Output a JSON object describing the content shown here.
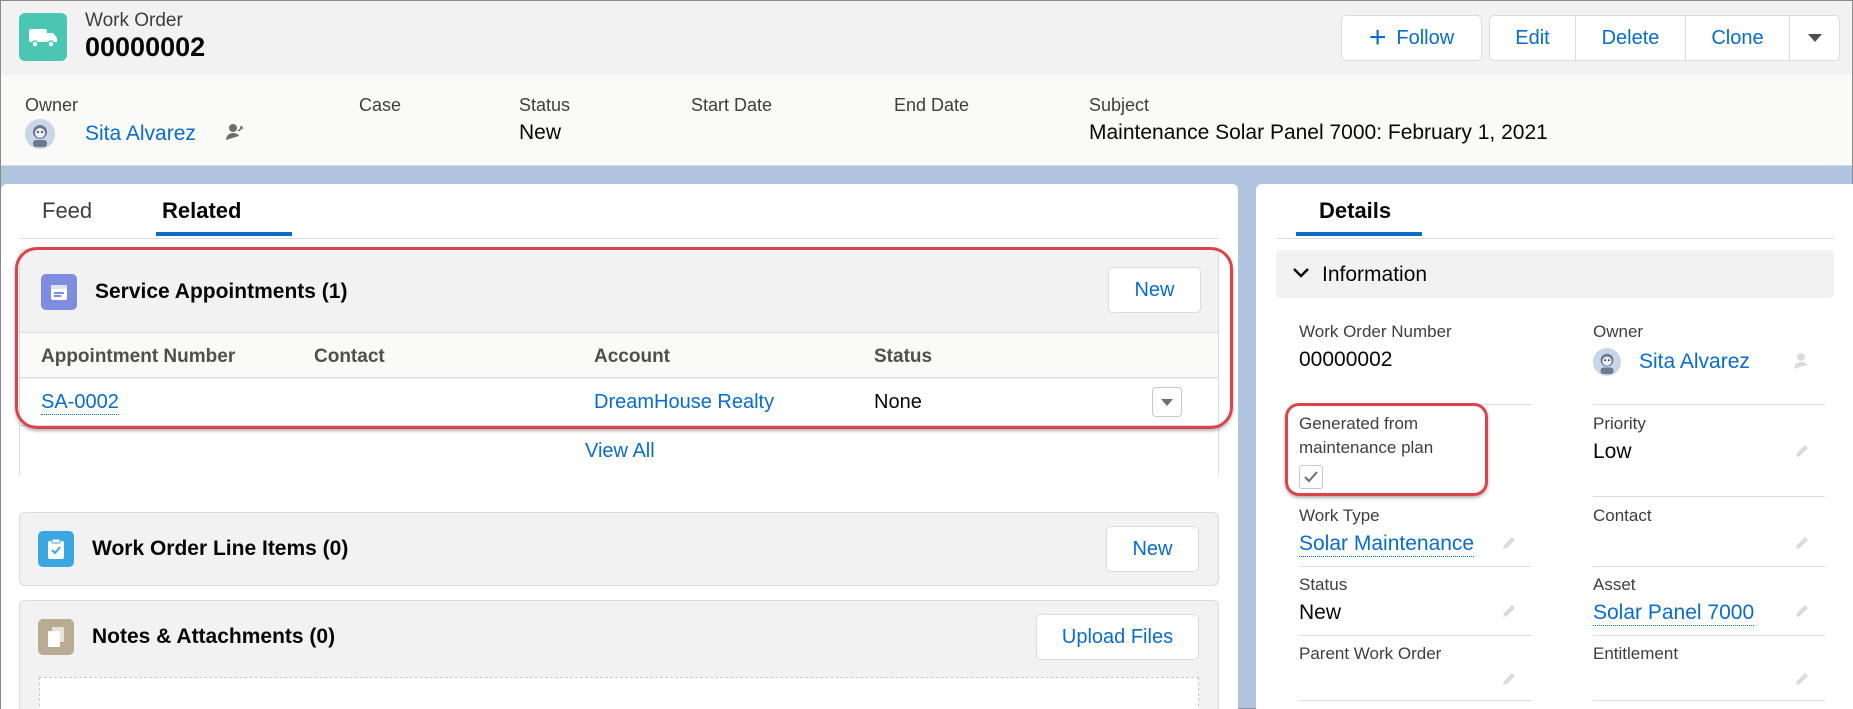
{
  "header": {
    "object_type": "Work Order",
    "record_name": "00000002",
    "buttons": {
      "follow": "Follow",
      "edit": "Edit",
      "delete": "Delete",
      "clone": "Clone"
    },
    "fields": {
      "owner_label": "Owner",
      "owner_value": "Sita Alvarez",
      "case_label": "Case",
      "status_label": "Status",
      "status_value": "New",
      "start_date_label": "Start Date",
      "end_date_label": "End Date",
      "subject_label": "Subject",
      "subject_value": "Maintenance Solar Panel 7000: February 1, 2021"
    }
  },
  "left": {
    "tabs": [
      "Feed",
      "Related"
    ],
    "active_tab": "Related",
    "service_appointments": {
      "title": "Service Appointments (1)",
      "new_label": "New",
      "columns": [
        "Appointment Number",
        "Contact",
        "Account",
        "Status"
      ],
      "rows": [
        {
          "appointment_number": "SA-0002",
          "contact": "",
          "account": "DreamHouse Realty",
          "status": "None"
        }
      ],
      "view_all": "View All"
    },
    "line_items": {
      "title": "Work Order Line Items (0)",
      "new_label": "New"
    },
    "notes": {
      "title": "Notes & Attachments (0)",
      "upload_label": "Upload Files"
    }
  },
  "right": {
    "tab": "Details",
    "section": "Information",
    "fields": {
      "work_order_number_label": "Work Order Number",
      "work_order_number_value": "00000002",
      "owner_label": "Owner",
      "owner_value": "Sita Alvarez",
      "generated_label_line1": "Generated from",
      "generated_label_line2": "maintenance plan",
      "generated_checked": true,
      "priority_label": "Priority",
      "priority_value": "Low",
      "work_type_label": "Work Type",
      "work_type_value": "Solar Maintenance",
      "contact_label": "Contact",
      "status_label": "Status",
      "status_value": "New",
      "asset_label": "Asset",
      "asset_value": "Solar Panel 7000",
      "parent_label": "Parent Work Order",
      "entitlement_label": "Entitlement"
    }
  },
  "colors": {
    "brand_blue": "#0b6bc7",
    "work_order_icon": "#4bc6b3",
    "service_appt_icon": "#7f8de1",
    "line_items_icon": "#3ba7e0",
    "notes_icon": "#baac93",
    "highlight": "#d9454a"
  }
}
